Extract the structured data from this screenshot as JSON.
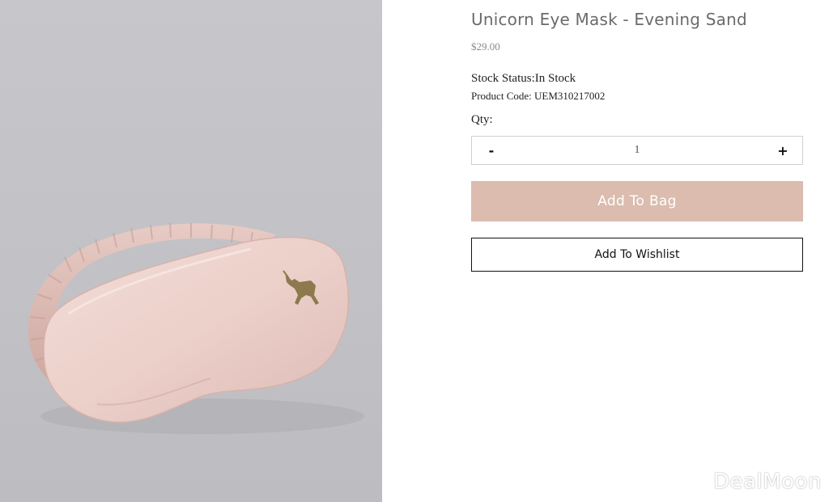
{
  "product": {
    "title": "Unicorn Eye Mask - Evening Sand",
    "price": "$29.00",
    "stock_status": "Stock Status:In Stock",
    "product_code": "Product Code: UEM310217002",
    "image_icon": "eye-mask-photo"
  },
  "quantity": {
    "label": "Qty:",
    "value": "1",
    "minus_label": "-",
    "plus_label": "+"
  },
  "actions": {
    "add_to_bag": "Add To Bag",
    "add_to_wishlist": "Add To Wishlist"
  },
  "watermark": "DealMoon",
  "colors": {
    "add_to_bag_bg": "#dbbcae",
    "title_text": "#6b6b6b",
    "photo_bg": "#c4c4c8"
  }
}
